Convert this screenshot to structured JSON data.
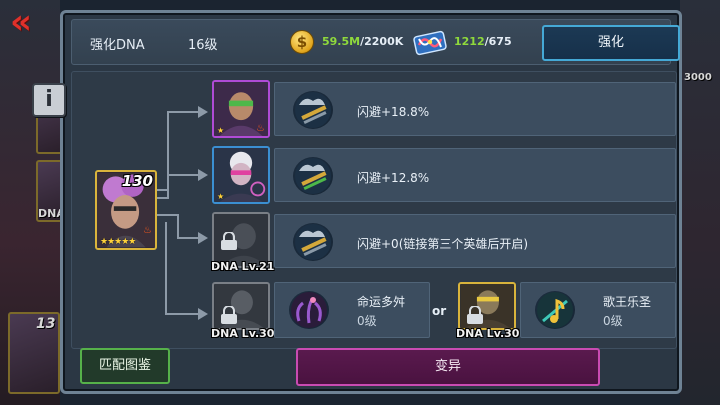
{
  "header": {
    "title": "强化DNA",
    "level": "16级",
    "coins_value": "59.5M",
    "coins_max": "/2200K",
    "dna_value": "1212",
    "dna_max": "/675",
    "enhance_label": "强化"
  },
  "main_hero": {
    "level": "130",
    "stars": "★★★★★"
  },
  "slots": [
    {
      "text": "闪避+18.8%",
      "hero_stars": "★"
    },
    {
      "text": "闪避+12.8%",
      "hero_stars": "★"
    },
    {
      "text": "闪避+0(链接第三个英雄后开启)",
      "lock_caption": "DNA Lv.21"
    }
  ],
  "choices": [
    {
      "name": "命运多舛",
      "level": "0级",
      "lock_caption": "DNA Lv.30"
    },
    {
      "name": "歌王乐圣",
      "level": "0级",
      "lock_caption": "DNA Lv.30"
    }
  ],
  "or_label": "or",
  "buttons": {
    "match_label": "匹配图鉴",
    "mutate_label": "变异"
  },
  "background": {
    "left_caption": "DNA",
    "left_number": "13",
    "right_number": "3000"
  },
  "colors": {
    "accent_blue": "#45a9d6",
    "accent_green": "#56b14a",
    "accent_magenta": "#c94bb2",
    "value_green": "#8fd93c",
    "back_red": "#e0302a"
  }
}
